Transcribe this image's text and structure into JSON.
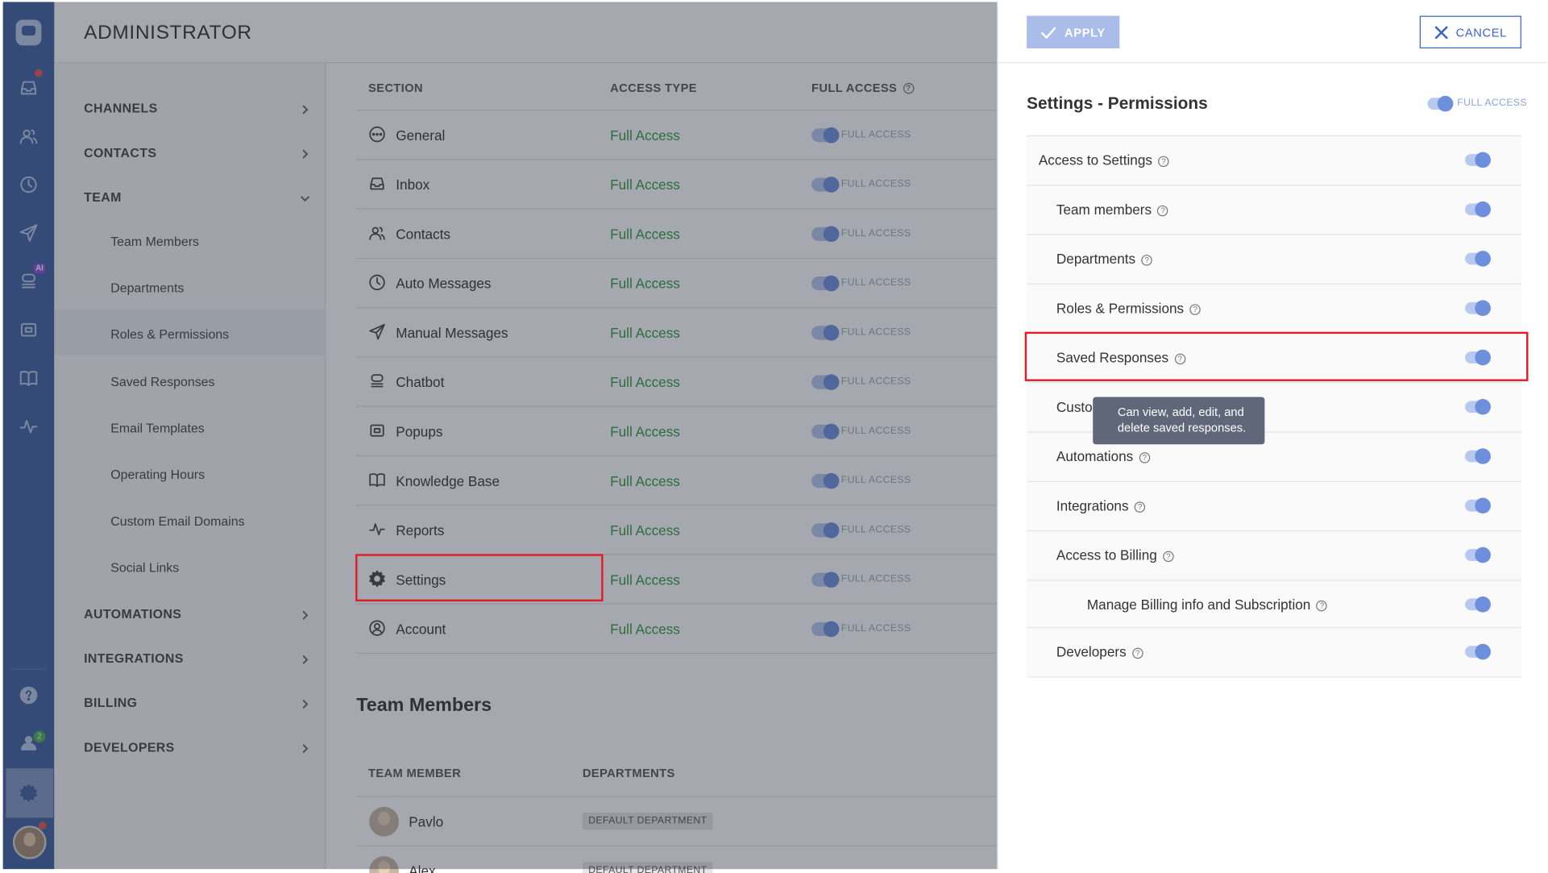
{
  "app": {
    "title": "ADMINISTRATOR"
  },
  "rail": {
    "icons": [
      "chat-logo-icon",
      "inbox-icon",
      "contacts-icon",
      "clock-icon",
      "send-icon",
      "chatbot-icon",
      "popup-icon",
      "book-icon",
      "activity-icon",
      "help-icon",
      "team-icon",
      "gear-icon",
      "user-avatar"
    ],
    "ai_badge": "AI",
    "team_badge": "2"
  },
  "nav": {
    "sections": [
      {
        "label": "CHANNELS"
      },
      {
        "label": "CONTACTS"
      },
      {
        "label": "TEAM"
      },
      {
        "label": "AUTOMATIONS"
      },
      {
        "label": "INTEGRATIONS"
      },
      {
        "label": "BILLING"
      },
      {
        "label": "DEVELOPERS"
      }
    ],
    "team_items": [
      {
        "label": "Team Members"
      },
      {
        "label": "Departments"
      },
      {
        "label": "Roles & Permissions"
      },
      {
        "label": "Saved Responses"
      },
      {
        "label": "Email Templates"
      },
      {
        "label": "Operating Hours"
      },
      {
        "label": "Custom Email Domains"
      },
      {
        "label": "Social Links"
      }
    ]
  },
  "table": {
    "headers": {
      "section": "SECTION",
      "access_type": "ACCESS TYPE",
      "full_access": "FULL ACCESS"
    },
    "help_glyph": "?",
    "rows": [
      {
        "name": "General",
        "access": "Full Access",
        "toggle": "FULL ACCESS",
        "icon": "dots-circle-icon"
      },
      {
        "name": "Inbox",
        "access": "Full Access",
        "toggle": "FULL ACCESS",
        "icon": "inbox-icon"
      },
      {
        "name": "Contacts",
        "access": "Full Access",
        "toggle": "FULL ACCESS",
        "icon": "contacts-icon"
      },
      {
        "name": "Auto Messages",
        "access": "Full Access",
        "toggle": "FULL ACCESS",
        "icon": "clock-icon"
      },
      {
        "name": "Manual Messages",
        "access": "Full Access",
        "toggle": "FULL ACCESS",
        "icon": "send-icon"
      },
      {
        "name": "Chatbot",
        "access": "Full Access",
        "toggle": "FULL ACCESS",
        "icon": "chatbot-icon"
      },
      {
        "name": "Popups",
        "access": "Full Access",
        "toggle": "FULL ACCESS",
        "icon": "popup-icon"
      },
      {
        "name": "Knowledge Base",
        "access": "Full Access",
        "toggle": "FULL ACCESS",
        "icon": "book-icon"
      },
      {
        "name": "Reports",
        "access": "Full Access",
        "toggle": "FULL ACCESS",
        "icon": "activity-icon"
      },
      {
        "name": "Settings",
        "access": "Full Access",
        "toggle": "FULL ACCESS",
        "icon": "gear-icon"
      },
      {
        "name": "Account",
        "access": "Full Access",
        "toggle": "FULL ACCESS",
        "icon": "account-icon"
      }
    ]
  },
  "team_members": {
    "title": "Team Members",
    "headers": {
      "member": "TEAM MEMBER",
      "departments": "DEPARTMENTS"
    },
    "rows": [
      {
        "name": "Pavlo",
        "department": "DEFAULT DEPARTMENT"
      },
      {
        "name": "Alex",
        "department": "DEFAULT DEPARTMENT"
      }
    ]
  },
  "panel": {
    "apply_label": "APPLY",
    "cancel_label": "CANCEL",
    "title": "Settings - Permissions",
    "full_access_label": "FULL ACCESS",
    "permissions": [
      {
        "label": "Access to Settings",
        "enabled": true
      },
      {
        "label": "Team members",
        "enabled": true
      },
      {
        "label": "Departments",
        "enabled": true
      },
      {
        "label": "Roles & Permissions",
        "enabled": true
      },
      {
        "label": "Saved Responses",
        "enabled": true
      },
      {
        "label": "Custo",
        "enabled": true
      },
      {
        "label": "Automations",
        "enabled": true
      },
      {
        "label": "Integrations",
        "enabled": true
      },
      {
        "label": "Access to Billing",
        "enabled": true
      },
      {
        "label": "Manage Billing info and Subscription",
        "enabled": true
      },
      {
        "label": "Developers",
        "enabled": true
      }
    ],
    "tooltip": {
      "line1": "Can view, add, edit, and",
      "line2": "delete saved responses."
    }
  },
  "colors": {
    "rail": "#3f5f9f",
    "accent": "#3b63c4",
    "full_access_text": "#2e9a3a",
    "highlight": "#e11d2a",
    "apply_button": "#a9bde8"
  }
}
